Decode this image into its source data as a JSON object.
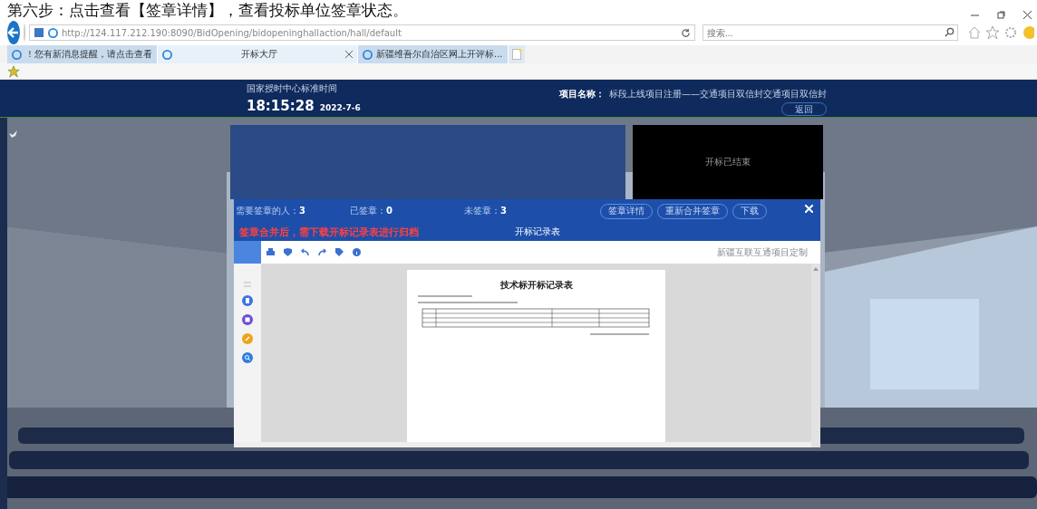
{
  "instruction": "第六步：点击查看【签章详情】，查看投标单位签章状态。",
  "browser": {
    "address": "http://124.117.212.190:8090/BidOpening/bidopeninghallaction/hall/default",
    "search": {
      "placeholder": "搜索..."
    },
    "tabs": [
      {
        "label": "！您有新消息提醒，请点击查看",
        "selected": false
      },
      {
        "label": "开标大厅",
        "selected": true
      },
      {
        "label": "新疆维吾尔自治区网上开评标...",
        "selected": false
      }
    ]
  },
  "app_header": {
    "clock_label": "国家授时中心标准时间",
    "time": "18:15:28",
    "date": "2022-7-6",
    "project_label": "项目名称：",
    "project_name": "标段上线项目注册——交通项目双信封交通项目双信封",
    "back_button": "返回"
  },
  "video_panel": {
    "status": "开标已结束"
  },
  "dialog": {
    "stats": [
      {
        "label": "需要签章的人：",
        "value": "3"
      },
      {
        "label": "已签章：",
        "value": "0"
      },
      {
        "label": "未签章：",
        "value": "3"
      }
    ],
    "buttons": [
      "签章详情",
      "重新合并签章",
      "下载"
    ],
    "notice": "签章合并后，需下载开标记录表进行归档",
    "title": "开标记录表",
    "toolbar_note": "新疆互联互通项目定制",
    "document": {
      "title": "技术标开标记录表"
    }
  }
}
